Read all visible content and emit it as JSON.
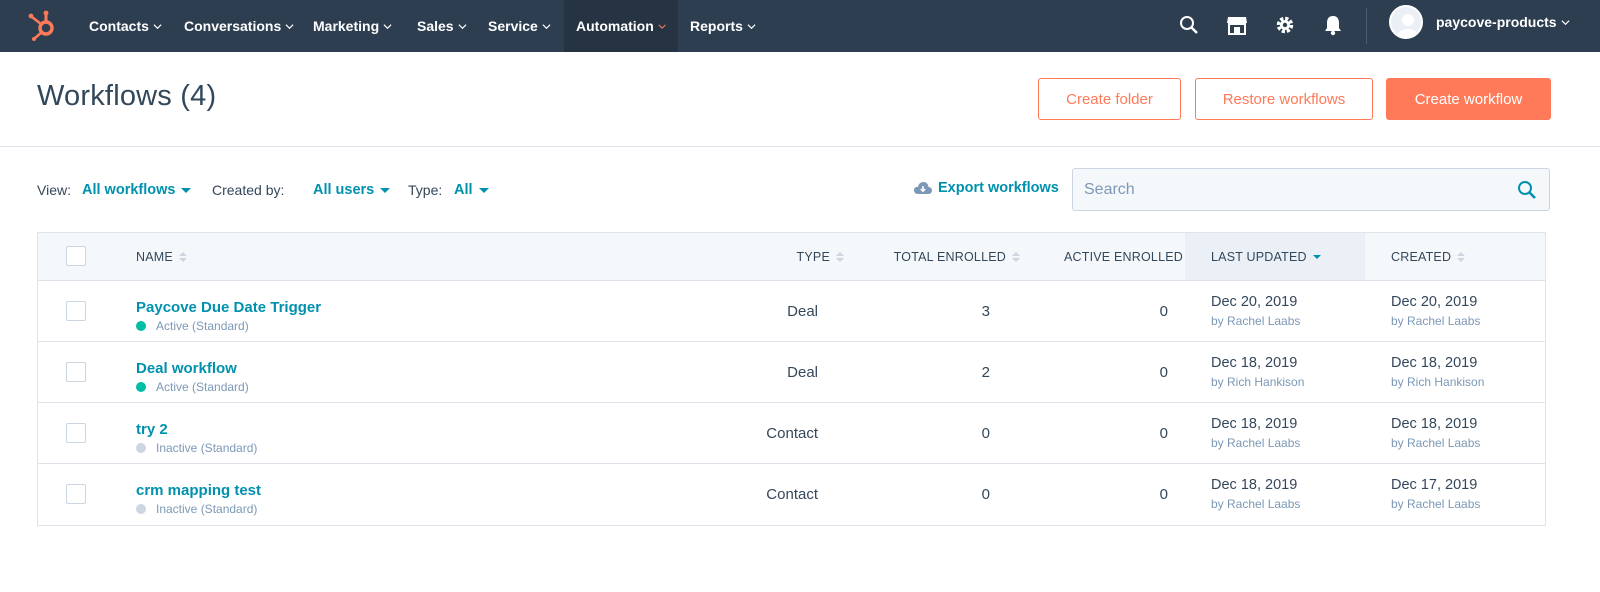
{
  "nav": {
    "items": [
      {
        "label": "Contacts",
        "active": false
      },
      {
        "label": "Conversations",
        "active": false
      },
      {
        "label": "Marketing",
        "active": false
      },
      {
        "label": "Sales",
        "active": false
      },
      {
        "label": "Service",
        "active": false
      },
      {
        "label": "Automation",
        "active": true
      },
      {
        "label": "Reports",
        "active": false
      }
    ],
    "account_name": "paycove-products",
    "icons": [
      "search-icon",
      "marketplace-icon",
      "settings-gear-icon",
      "notifications-bell-icon"
    ]
  },
  "header": {
    "title": "Workflows (4)",
    "create_folder": "Create folder",
    "restore_workflows": "Restore workflows",
    "create_workflow": "Create workflow"
  },
  "filters": {
    "view_label": "View:",
    "view_value": "All workflows",
    "created_by_label": "Created by:",
    "created_by_value": "All users",
    "type_label": "Type:",
    "type_value": "All",
    "export": "Export workflows"
  },
  "search": {
    "placeholder": "Search"
  },
  "table": {
    "columns": {
      "name": "NAME",
      "type": "TYPE",
      "total_enrolled": "TOTAL ENROLLED",
      "active_enrolled": "ACTIVE ENROLLED",
      "last_updated": "LAST UPDATED",
      "created": "CREATED"
    },
    "sorted_column": "last_updated",
    "rows": [
      {
        "name": "Paycove Due Date Trigger",
        "status": "Active (Standard)",
        "active": true,
        "type": "Deal",
        "total_enrolled": "3",
        "active_enrolled": "0",
        "last_updated": "Dec 20, 2019",
        "last_updated_by": "by Rachel Laabs",
        "created": "Dec 20, 2019",
        "created_by": "by Rachel Laabs"
      },
      {
        "name": "Deal workflow",
        "status": "Active (Standard)",
        "active": true,
        "type": "Deal",
        "total_enrolled": "2",
        "active_enrolled": "0",
        "last_updated": "Dec 18, 2019",
        "last_updated_by": "by Rich Hankison",
        "created": "Dec 18, 2019",
        "created_by": "by Rich Hankison"
      },
      {
        "name": "try 2",
        "status": "Inactive (Standard)",
        "active": false,
        "type": "Contact",
        "total_enrolled": "0",
        "active_enrolled": "0",
        "last_updated": "Dec 18, 2019",
        "last_updated_by": "by Rachel Laabs",
        "created": "Dec 18, 2019",
        "created_by": "by Rachel Laabs"
      },
      {
        "name": "crm mapping test",
        "status": "Inactive (Standard)",
        "active": false,
        "type": "Contact",
        "total_enrolled": "0",
        "active_enrolled": "0",
        "last_updated": "Dec 18, 2019",
        "last_updated_by": "by Rachel Laabs",
        "created": "Dec 17, 2019",
        "created_by": "by Rachel Laabs"
      }
    ]
  },
  "colors": {
    "nav_bg": "#2d3e50",
    "accent": "#ff7a59",
    "link": "#0091ae",
    "status_active": "#00bda5",
    "status_inactive": "#cbd6e2"
  }
}
